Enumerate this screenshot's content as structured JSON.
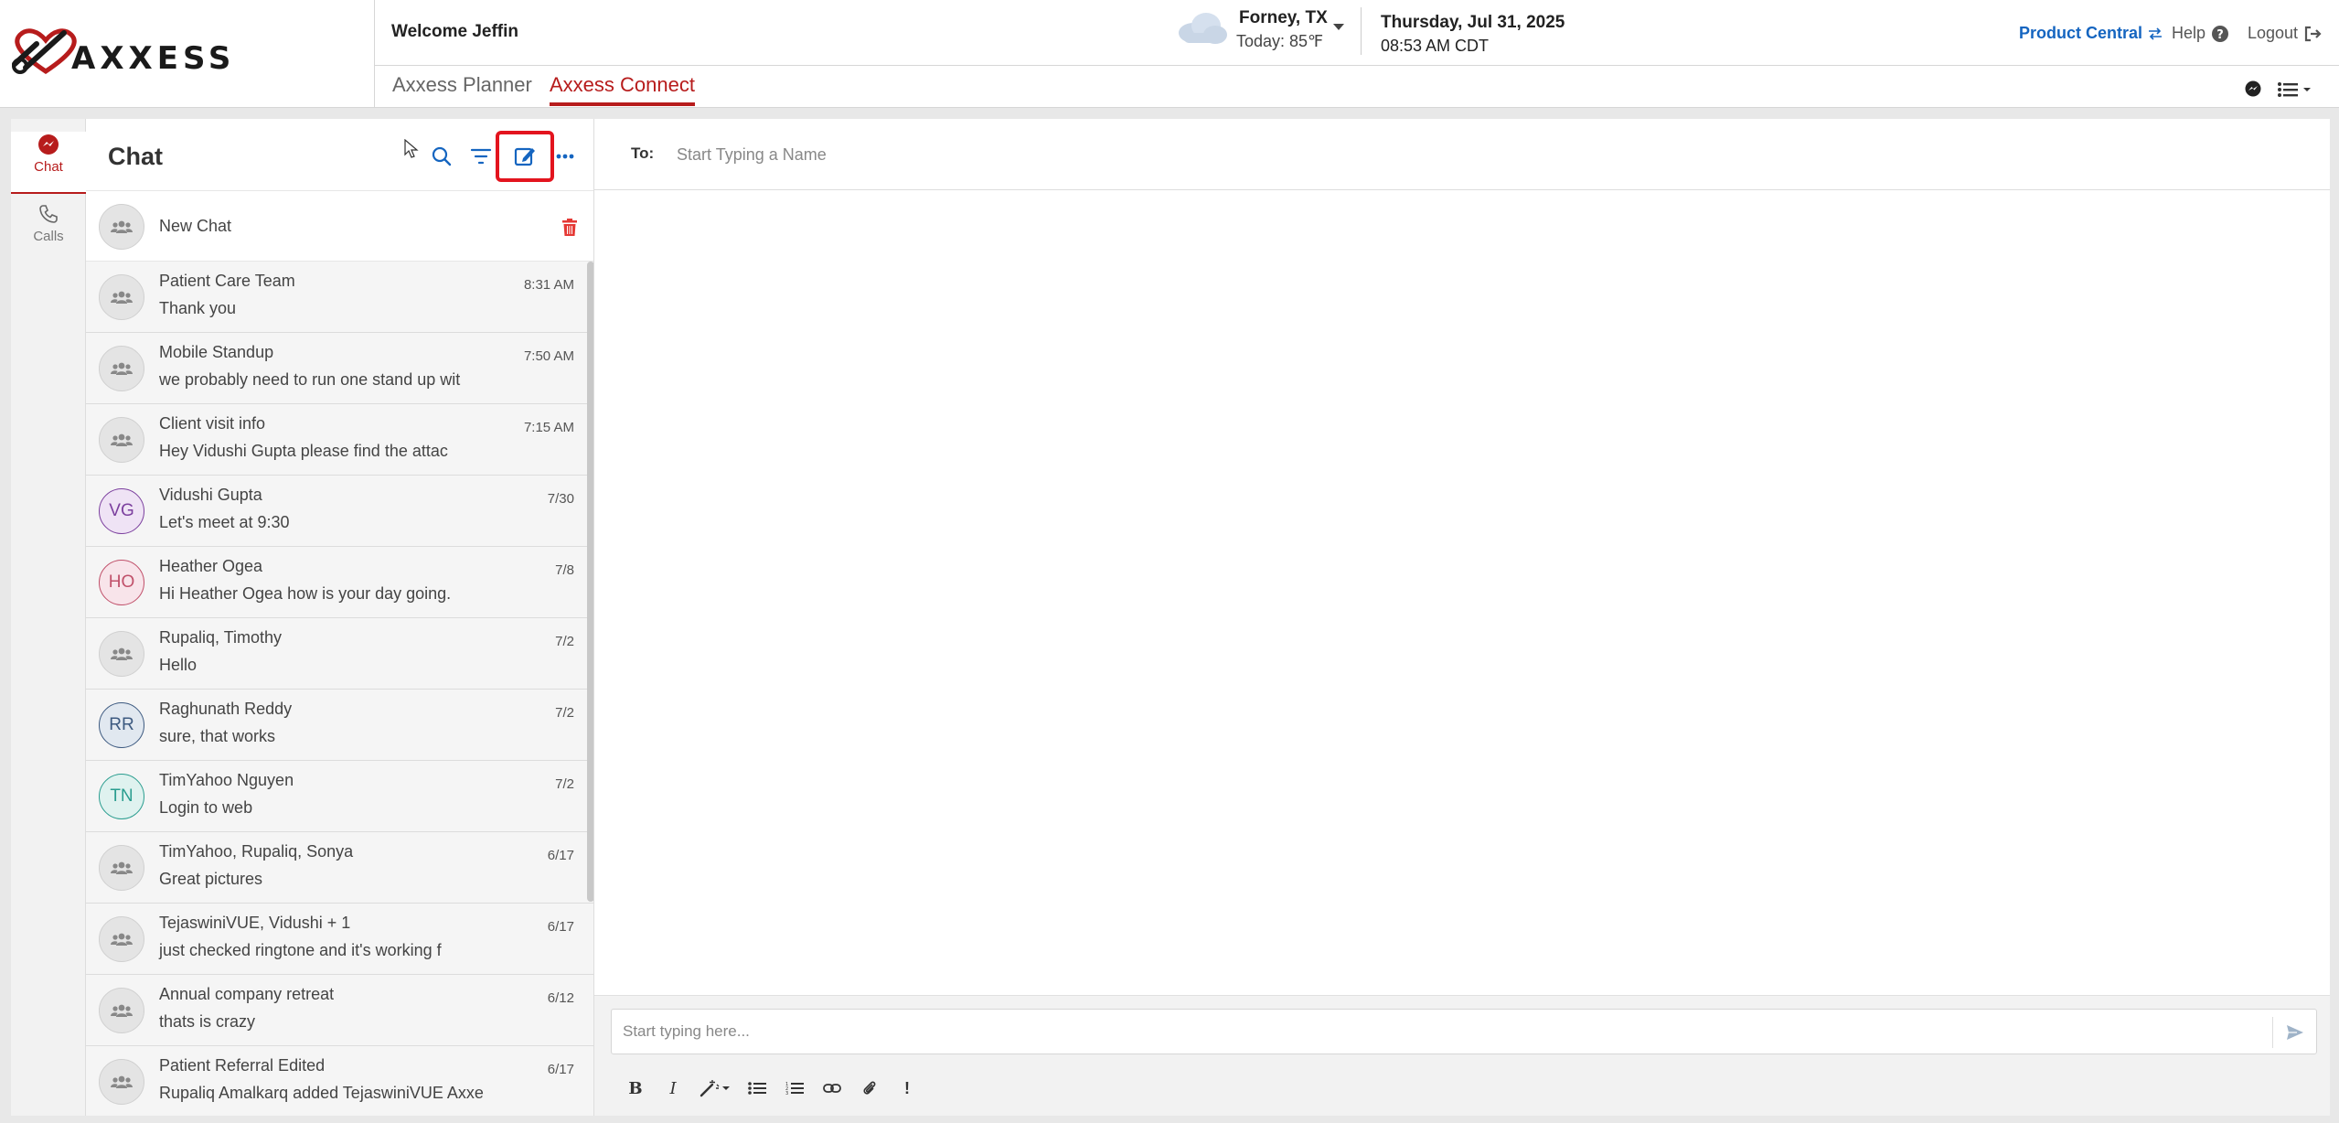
{
  "brand": {
    "name": "AXXESS"
  },
  "header": {
    "welcome": "Welcome Jeffin",
    "tabs": [
      {
        "label": "Axxess Planner",
        "active": false
      },
      {
        "label": "Axxess Connect",
        "active": true
      }
    ],
    "weather": {
      "city": "Forney, TX",
      "today": "Today:  85℉"
    },
    "date": "Thursday, Jul 31, 2025",
    "time": "08:53 AM CDT",
    "links": {
      "product_central": "Product Central",
      "help": "Help",
      "logout": "Logout"
    }
  },
  "rail": {
    "items": [
      {
        "label": "Chat",
        "icon": "chat-bubble-icon",
        "active": true
      },
      {
        "label": "Calls",
        "icon": "phone-icon",
        "active": false
      }
    ]
  },
  "chat_panel": {
    "title": "Chat",
    "new_chat_label": "New Chat",
    "chats": [
      {
        "name": "Patient Care Team",
        "message": "Thank you",
        "time": "8:31 AM",
        "avatar": "group"
      },
      {
        "name": "Mobile Standup",
        "message": "we probably need to run one stand up wit",
        "time": "7:50 AM",
        "avatar": "group"
      },
      {
        "name": "Client visit info",
        "message": "Hey Vidushi Gupta  please find the attac",
        "time": "7:15 AM",
        "avatar": "group"
      },
      {
        "name": "Vidushi Gupta",
        "message": "Let's meet at 9:30",
        "time": "7/30",
        "avatar": "VG"
      },
      {
        "name": "Heather Ogea",
        "message": "Hi Heather Ogea how is your day going.",
        "time": "7/8",
        "avatar": "HO"
      },
      {
        "name": "Rupaliq, Timothy",
        "message": "Hello",
        "time": "7/2",
        "avatar": "group"
      },
      {
        "name": "Raghunath Reddy",
        "message": "sure, that works",
        "time": "7/2",
        "avatar": "RR"
      },
      {
        "name": "TimYahoo Nguyen",
        "message": "Login to web",
        "time": "7/2",
        "avatar": "TN"
      },
      {
        "name": "TimYahoo, Rupaliq, Sonya",
        "message": "Great pictures",
        "time": "6/17",
        "avatar": "group"
      },
      {
        "name": "TejaswiniVUE, Vidushi + 1",
        "message": "just checked ringtone and it's working f",
        "time": "6/17",
        "avatar": "group"
      },
      {
        "name": "Annual company retreat",
        "message": "thats is crazy",
        "time": "6/12",
        "avatar": "group"
      },
      {
        "name": "Patient Referral Edited",
        "message": "Rupaliq Amalkarq added TejaswiniVUE Axxe",
        "time": "6/17",
        "avatar": "group"
      }
    ]
  },
  "conversation": {
    "to_label": "To:",
    "to_placeholder": "Start Typing a Name",
    "compose_placeholder": "Start typing here..."
  },
  "colors": {
    "brand_red": "#b71c1c",
    "link_blue": "#1565c0",
    "highlight_red": "#e3141e",
    "avatar_vg": "#7b3f9e",
    "avatar_ho": "#c0506a",
    "avatar_rr": "#3d5a80",
    "avatar_tn": "#2a9d8f"
  }
}
